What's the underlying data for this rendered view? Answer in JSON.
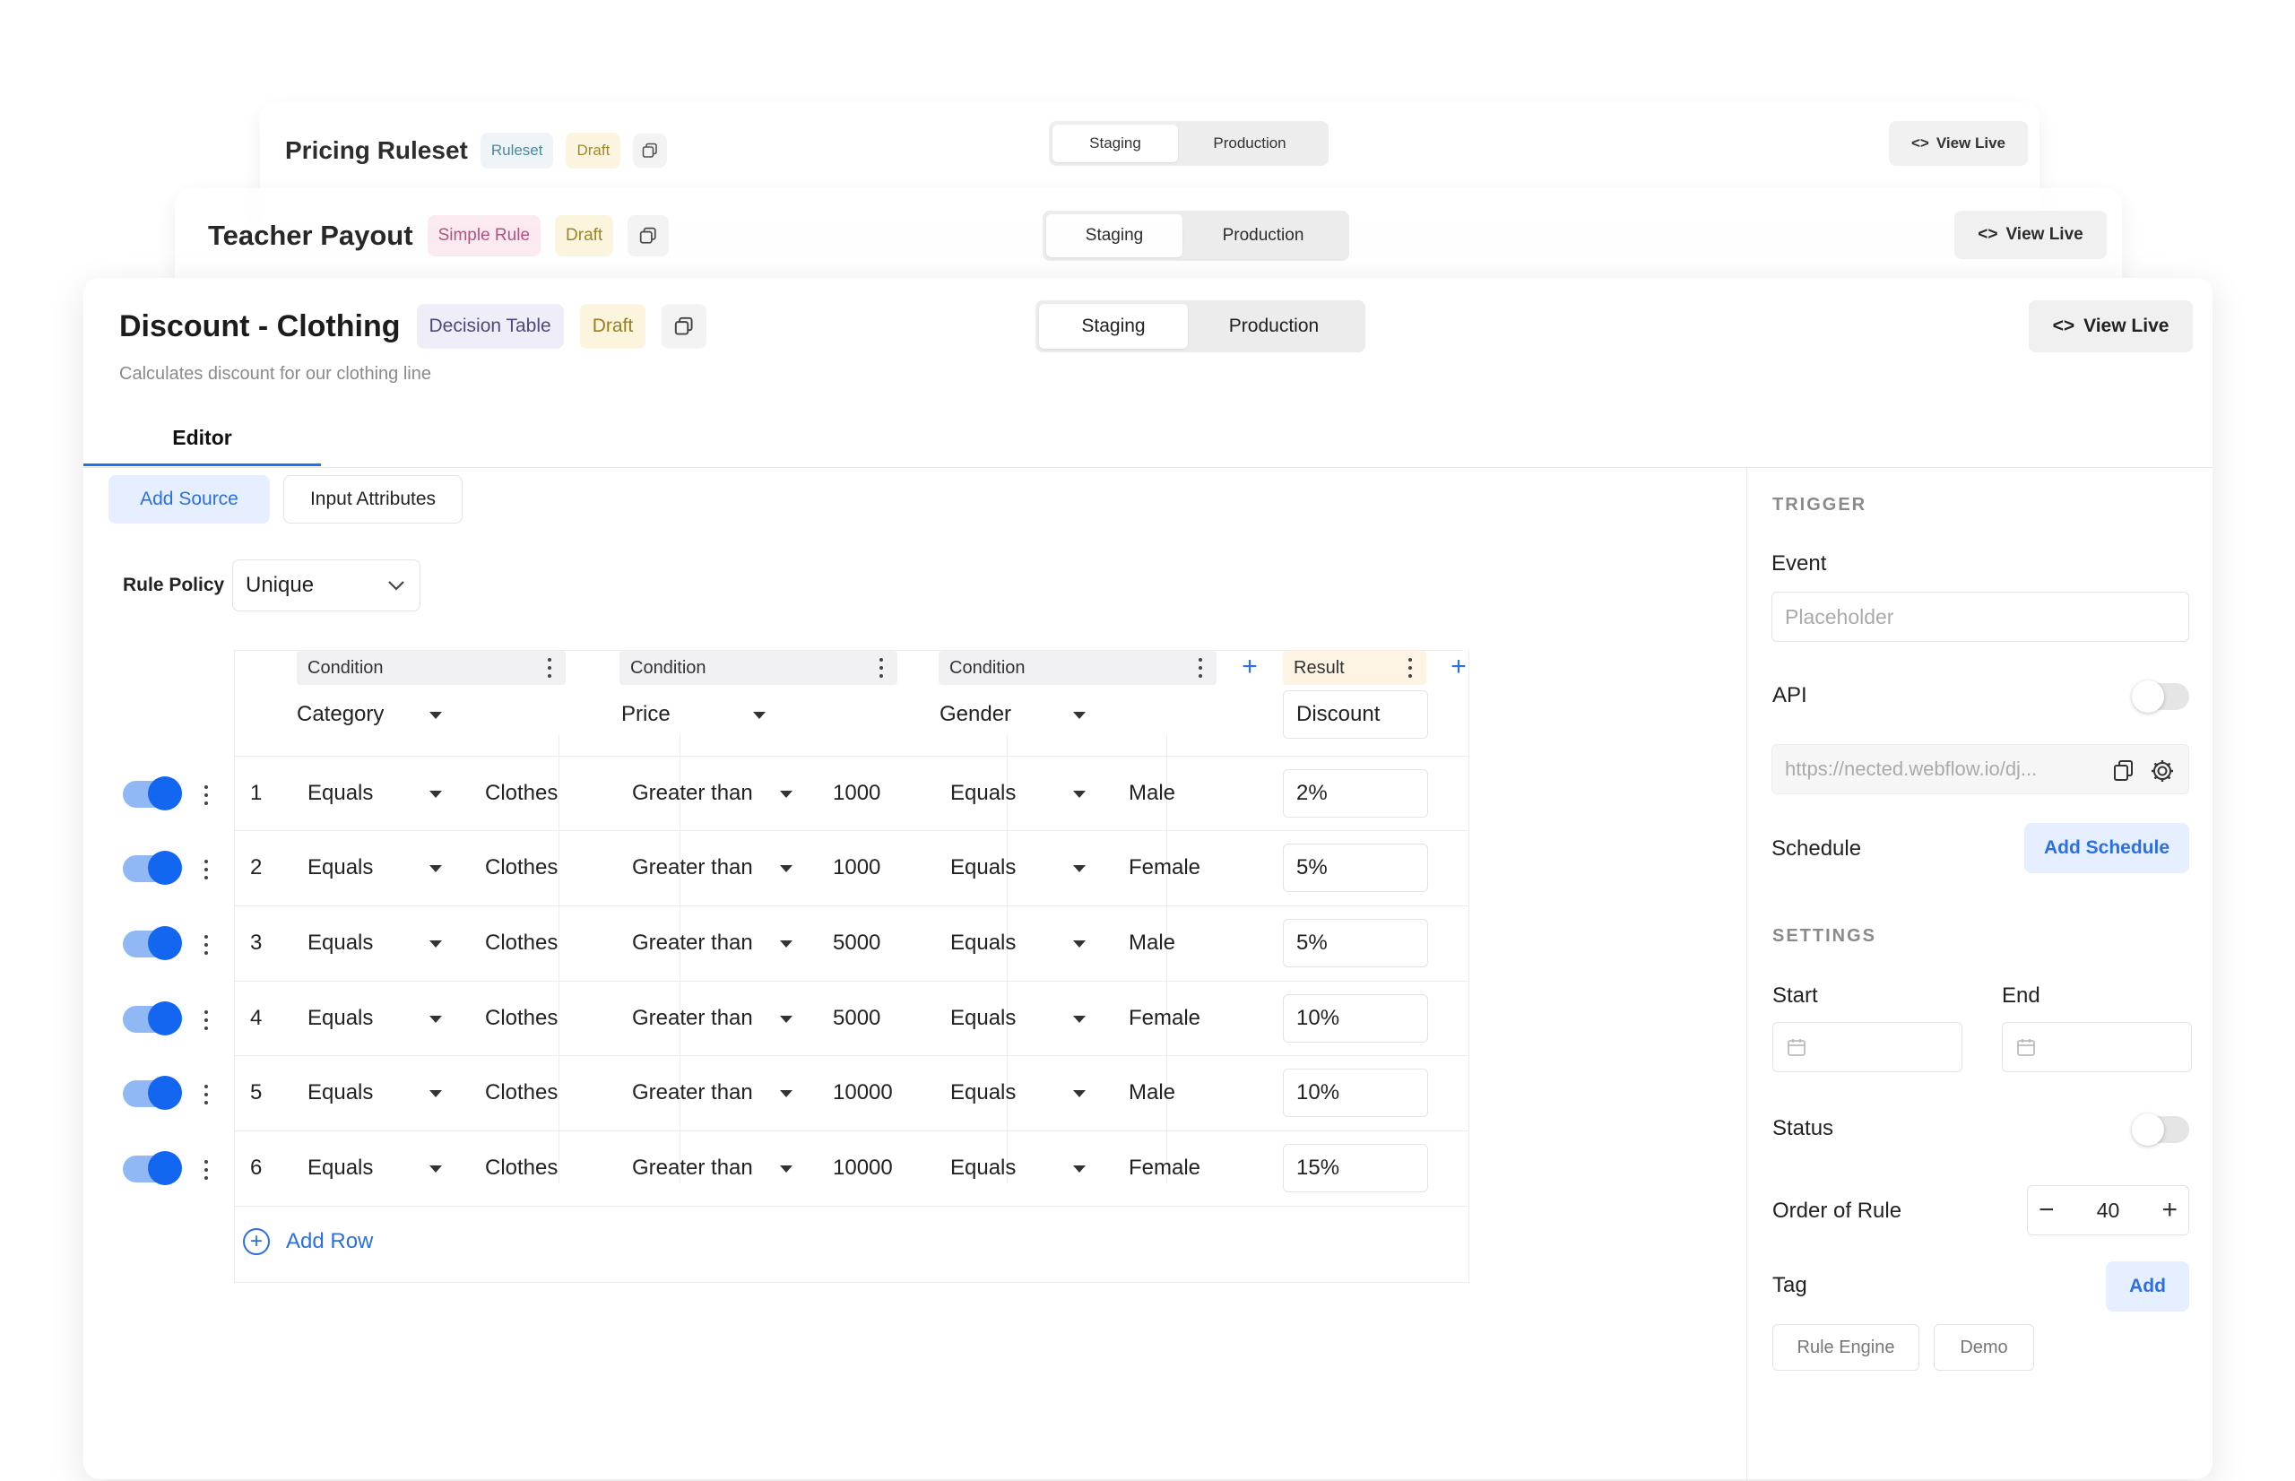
{
  "back_card_2": {
    "title": "Pricing Ruleset",
    "type_badge": "Ruleset",
    "status_badge": "Draft",
    "env_tabs": [
      "Staging",
      "Production"
    ],
    "view_live": "View Live"
  },
  "back_card_1": {
    "title": "Teacher Payout",
    "type_badge": "Simple Rule",
    "status_badge": "Draft",
    "env_tabs": [
      "Staging",
      "Production"
    ],
    "view_live": "View Live"
  },
  "main": {
    "title": "Discount - Clothing",
    "type_badge": "Decision Table",
    "status_badge": "Draft",
    "env_tabs": [
      "Staging",
      "Production"
    ],
    "active_env": "Staging",
    "view_live": "View Live",
    "description": "Calculates discount for our clothing line",
    "tab": "Editor",
    "add_source": "Add Source",
    "input_attributes": "Input Attributes",
    "rule_policy_label": "Rule Policy",
    "rule_policy_value": "Unique",
    "columns": [
      {
        "header": "Condition",
        "field": "Category"
      },
      {
        "header": "Condition",
        "field": "Price"
      },
      {
        "header": "Condition",
        "field": "Gender"
      },
      {
        "header": "Result",
        "field": "Discount"
      }
    ],
    "rows": [
      {
        "n": "1",
        "enabled": true,
        "c1_op": "Equals",
        "c1_val": "Clothes",
        "c2_op": "Greater than",
        "c2_val": "1000",
        "c3_op": "Equals",
        "c3_val": "Male",
        "result": "2%"
      },
      {
        "n": "2",
        "enabled": true,
        "c1_op": "Equals",
        "c1_val": "Clothes",
        "c2_op": "Greater than",
        "c2_val": "1000",
        "c3_op": "Equals",
        "c3_val": "Female",
        "result": "5%"
      },
      {
        "n": "3",
        "enabled": true,
        "c1_op": "Equals",
        "c1_val": "Clothes",
        "c2_op": "Greater than",
        "c2_val": "5000",
        "c3_op": "Equals",
        "c3_val": "Male",
        "result": "5%"
      },
      {
        "n": "4",
        "enabled": true,
        "c1_op": "Equals",
        "c1_val": "Clothes",
        "c2_op": "Greater than",
        "c2_val": "5000",
        "c3_op": "Equals",
        "c3_val": "Female",
        "result": "10%"
      },
      {
        "n": "5",
        "enabled": true,
        "c1_op": "Equals",
        "c1_val": "Clothes",
        "c2_op": "Greater than",
        "c2_val": "10000",
        "c3_op": "Equals",
        "c3_val": "Male",
        "result": "10%"
      },
      {
        "n": "6",
        "enabled": true,
        "c1_op": "Equals",
        "c1_val": "Clothes",
        "c2_op": "Greater than",
        "c2_val": "10000",
        "c3_op": "Equals",
        "c3_val": "Female",
        "result": "15%"
      }
    ],
    "add_row": "Add Row"
  },
  "sidebar": {
    "trigger_title": "TRIGGER",
    "event_label": "Event",
    "event_placeholder": "Placeholder",
    "api_label": "API",
    "api_enabled": false,
    "api_url": "https://nected.webflow.io/dj...",
    "schedule_label": "Schedule",
    "add_schedule": "Add Schedule",
    "settings_title": "SETTINGS",
    "start_label": "Start",
    "end_label": "End",
    "status_label": "Status",
    "status_enabled": false,
    "order_label": "Order of Rule",
    "order_value": "40",
    "tag_label": "Tag",
    "tag_add": "Add",
    "tags": [
      "Rule Engine",
      "Demo"
    ]
  }
}
